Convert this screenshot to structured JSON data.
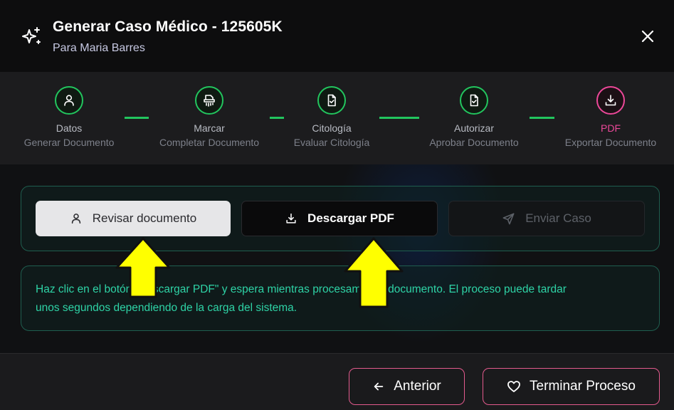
{
  "header": {
    "title": "Generar Caso Médico - 125605K",
    "subtitle": "Para Maria Barres",
    "icons": {
      "title": "sparkles-icon",
      "close": "close-icon"
    }
  },
  "steps": [
    {
      "label": "Datos",
      "sub": "Generar Documento",
      "status": "done",
      "icon": "user-icon"
    },
    {
      "label": "Marcar",
      "sub": "Completar Documento",
      "status": "done",
      "icon": "shredder-icon"
    },
    {
      "label": "Citología",
      "sub": "Evaluar Citología",
      "status": "done",
      "icon": "file-check-icon"
    },
    {
      "label": "Autorizar",
      "sub": "Aprobar Documento",
      "status": "done",
      "icon": "file-check-icon"
    },
    {
      "label": "PDF",
      "sub": "Exportar Documento",
      "status": "active",
      "icon": "download-icon"
    }
  ],
  "actions": {
    "review_label": "Revisar documento",
    "download_label": "Descargar PDF",
    "send_label": "Enviar Caso"
  },
  "info": {
    "text_line1": "Haz clic en el botón \"Descargar PDF\" y espera mientras procesamos tu documento. El proceso puede tardar",
    "text_line2": "unos segundos dependiendo de la carga del sistema."
  },
  "footer": {
    "prev_label": "Anterior",
    "finish_label": "Terminar Proceso"
  },
  "colors": {
    "step_done": "#22c55e",
    "step_active": "#ec4899",
    "info_text": "#2ed3a6",
    "footer_border": "#e35a8d",
    "annotation_arrow": "#ffff00"
  }
}
